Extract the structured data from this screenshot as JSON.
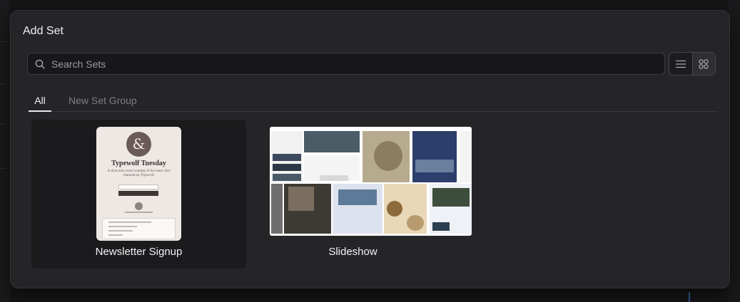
{
  "dialog": {
    "title": "Add Set",
    "search": {
      "placeholder": "Search Sets",
      "value": ""
    },
    "view_toggle": {
      "options": [
        "list-view",
        "grid-view"
      ],
      "active": "grid-view"
    },
    "tabs": [
      {
        "label": "All",
        "active": true
      },
      {
        "label": "New Set Group",
        "active": false
      }
    ],
    "sets": [
      {
        "label": "Newsletter Signup",
        "selected": true,
        "preview": {
          "glyph": "&",
          "title": "Typewolf Tuesday",
          "subtitle": "A short and sweet roundup of the latest sites featured on Typewolf"
        }
      },
      {
        "label": "Slideshow",
        "selected": false
      }
    ]
  },
  "colors": {
    "background": "#161618",
    "panel": "#252528",
    "accent_text": "#f2f2f4",
    "muted_text": "#7d7d83"
  }
}
